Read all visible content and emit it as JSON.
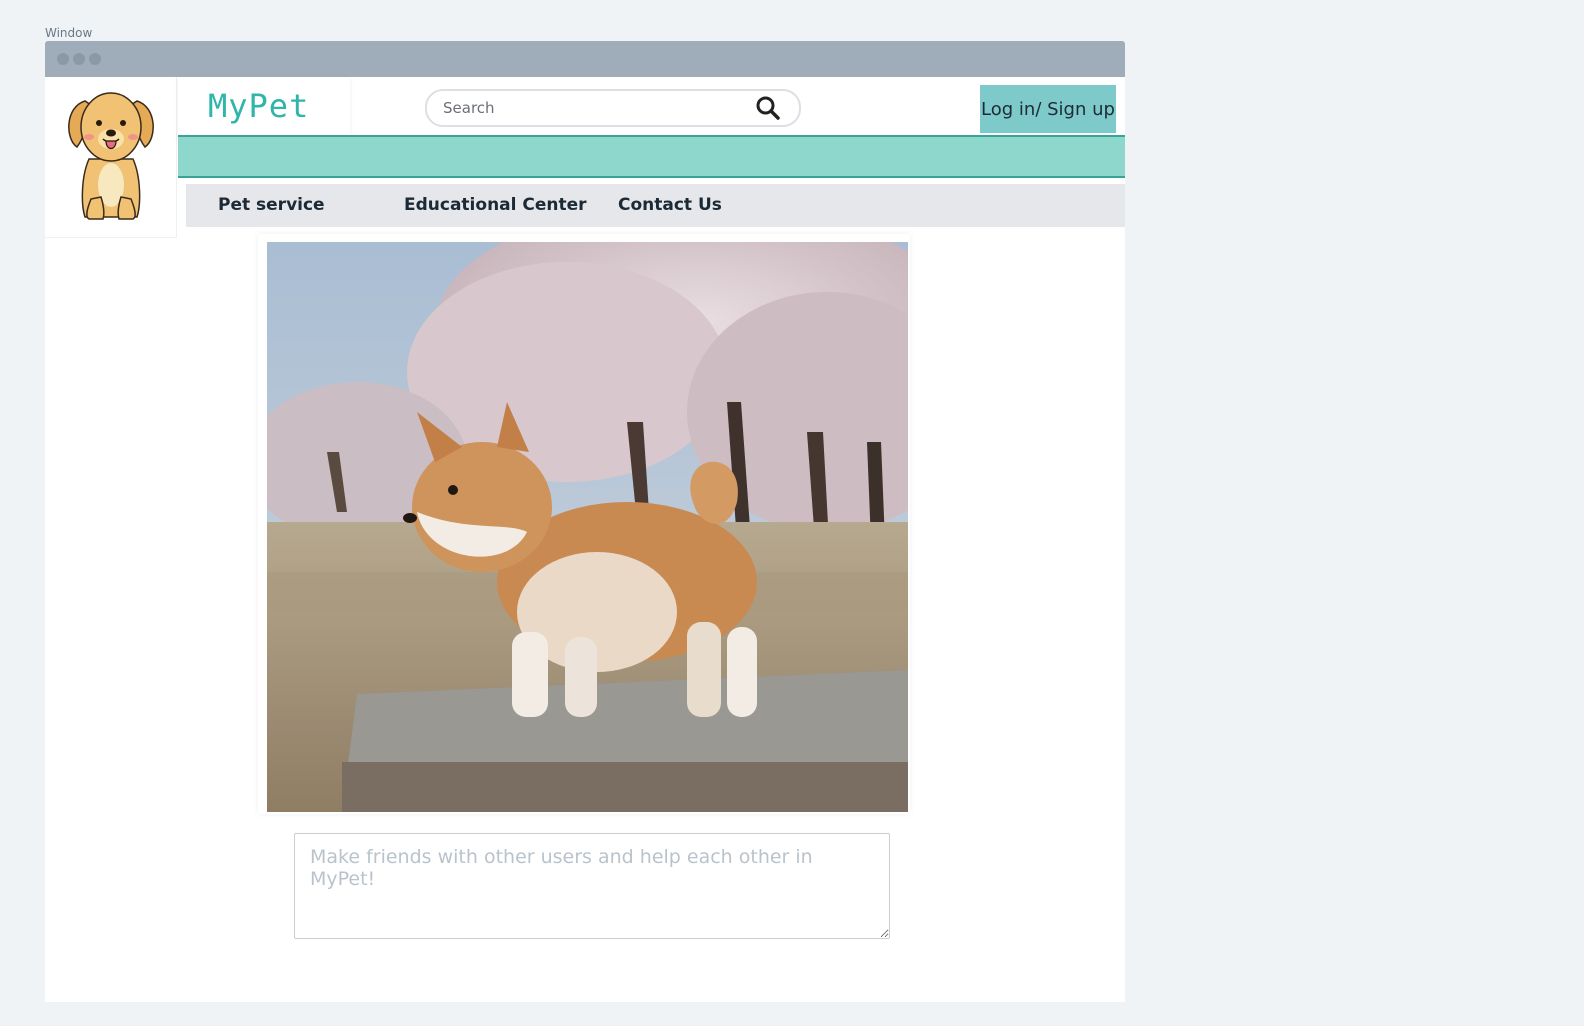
{
  "window": {
    "label": "Window"
  },
  "brand": {
    "name": "MyPet"
  },
  "search": {
    "placeholder": "Search"
  },
  "auth": {
    "login_label": "Log in/ Sign up"
  },
  "nav": {
    "items": [
      {
        "label": "Pet service"
      },
      {
        "label": "Educational Center"
      },
      {
        "label": "Contact Us"
      }
    ]
  },
  "hero": {
    "image": "shiba-inu-puppy-photo"
  },
  "message": {
    "placeholder": "Make friends with other users and help each other in MyPet!",
    "value": ""
  },
  "colors": {
    "accent": "#2fb5aa",
    "band": "#8dd7cd",
    "login_bg": "#7ecacb",
    "nav_bg": "#e6e7ea"
  },
  "icons": [
    "mascot-dog-icon",
    "search-icon"
  ]
}
